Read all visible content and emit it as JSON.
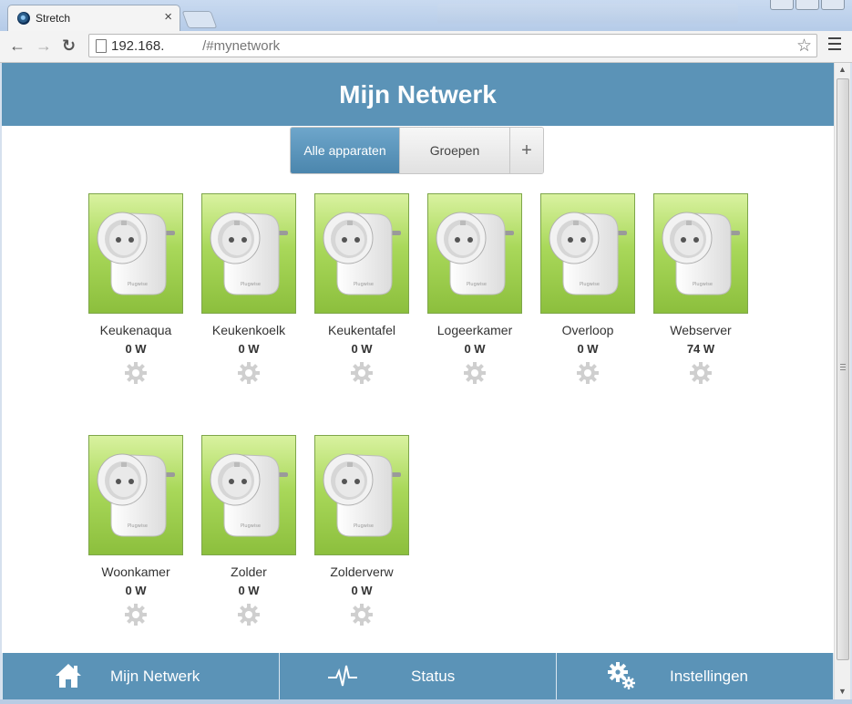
{
  "browser": {
    "tab_title": "Stretch",
    "tab_close": "×",
    "url_host": "192.168.",
    "url_path": "/#mynetwork",
    "back": "←",
    "forward": "→",
    "reload": "↻",
    "bookmark": "☆"
  },
  "header": {
    "title": "Mijn Netwerk"
  },
  "segments": [
    {
      "label": "Alle apparaten",
      "active": true
    },
    {
      "label": "Groepen",
      "active": false
    },
    {
      "label": "+",
      "active": false
    }
  ],
  "devices": [
    {
      "name": "Keukenaqua",
      "power": "0 W",
      "icon": "smart-plug-icon"
    },
    {
      "name": "Keukenkoelk",
      "power": "0 W",
      "icon": "smart-plug-icon"
    },
    {
      "name": "Keukentafel",
      "power": "0 W",
      "icon": "smart-plug-icon"
    },
    {
      "name": "Logeerkamer",
      "power": "0 W",
      "icon": "smart-plug-icon"
    },
    {
      "name": "Overloop",
      "power": "0 W",
      "icon": "smart-plug-icon"
    },
    {
      "name": "Webserver",
      "power": "74 W",
      "icon": "smart-plug-icon"
    },
    {
      "name": "Woonkamer",
      "power": "0 W",
      "icon": "smart-plug-icon"
    },
    {
      "name": "Zolder",
      "power": "0 W",
      "icon": "smart-plug-icon"
    },
    {
      "name": "Zolderverw",
      "power": "0 W",
      "icon": "smart-plug-icon"
    }
  ],
  "bottom_nav": [
    {
      "label": "Mijn Netwerk",
      "icon": "home-icon"
    },
    {
      "label": "Status",
      "icon": "pulse-icon"
    },
    {
      "label": "Instellingen",
      "icon": "gears-icon"
    }
  ],
  "colors": {
    "header": "#5b93b7",
    "active_segment": "#5b93b7",
    "device_tile": "#a9d85a"
  }
}
